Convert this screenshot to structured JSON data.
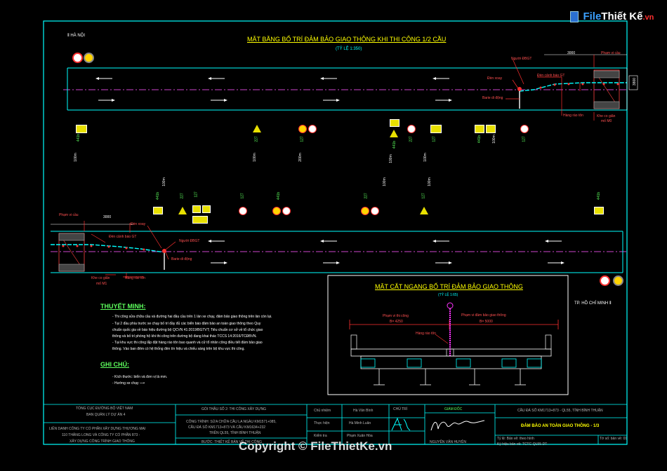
{
  "logo": {
    "brand_a": "File",
    "brand_b": "Thiết Kế",
    "brand_c": ".vn"
  },
  "plan": {
    "title": "MẶT BẰNG BỐ TRÍ ĐẢM BẢO GIAO THÔNG KHI THI CÔNG 1/2 CẦU",
    "scale": "(TỶ LỆ 1:350)",
    "dir_top": "HÀ NỘI",
    "dir_bottom": "TP. HỒ CHÍ MINH"
  },
  "labels_top": {
    "nguoi_dieu_tiet": "Người ĐBGT",
    "den_xoay": "Đèn xoay",
    "den_canh_bao": "Đèn cảnh báo GT",
    "barie": "Barie di động",
    "hang_rao": "Hàng rào tôn",
    "khe_co_gian": "Khe co giãn",
    "mo": "mố M0",
    "pham_vi_cau": "Phạm vi cầu",
    "dim_3000": "3000",
    "dim_3800": "3800"
  },
  "labels_bottom": {
    "pham_vi_cau": "Phạm vi cầu",
    "dim_3000": "3000",
    "den_xoay": "Đèn xoay",
    "den_canh_bao": "Đèn cảnh báo GT",
    "nguoi_dieu_tiet": "Người ĐBGT",
    "barie": "Barie di động",
    "khe_co_gian": "Khe co giãn",
    "mo": "mố M1",
    "hang_rao": "Hàng rào tôn"
  },
  "signs_top_codes": [
    "441b",
    "227",
    "127",
    "441b",
    "227",
    "127",
    "441b",
    "127"
  ],
  "signs_top_dists": [
    "100m",
    "100m",
    "200m",
    "100m",
    "100m",
    "100m",
    "100m",
    "100m"
  ],
  "signs_bot_codes": [
    "441b",
    "227",
    "127",
    "127",
    "441b",
    "227",
    "127",
    "441b"
  ],
  "signs_bot_dists": [
    "100m",
    "100m",
    "200m",
    "100m",
    "100m",
    "100m",
    "100m",
    "100m"
  ],
  "explanation": {
    "heading": "THUYẾT MINH:",
    "lines": [
      "- Thi công sửa chữa cầu và đường hai đầu cầu trên 1 làn xe chạy, đảm bảo giao thông trên làn còn lại.",
      "- Tại 2 đầu phía trước xe chạy bố trí đầy đủ các biển báo đảm bảo an toàn giao thông theo Quy",
      "chuẩn quốc gia về báo hiệu đường bộ QCVN 41:2019/BGTVT; Tiêu chuẩn cơ sở về tổ chức giao",
      "thông và bố trí phòng hộ khi thi công trên đường bộ đang khai thác TCCS 14:2016/TCĐBVN.",
      "- Tại khu vực thi công lắp đặt hàng rào tôn bao quanh và cử tổ nhân công điều tiết đảm bảo giao",
      "thông. Vào ban đêm có hệ thống đèn tín hiệu và chiếu sáng trên bộ khu vực thi công."
    ],
    "notes_heading": "GHI CHÚ:",
    "notes": [
      "- Kích thước: biển và đơn vị là mm.",
      "- Hướng xe chạy"
    ]
  },
  "section": {
    "title": "MẶT CẮT NGANG BỐ TRÍ ĐẢM BẢO GIAO THÔNG",
    "scale": "(TỶ LỆ 1:65)",
    "left_label": "Phạm vi thi công",
    "left_dim": "B= 4250",
    "right_label": "Phạm vi đảm bảo giao thông",
    "right_dim": "B= 5000",
    "fence": "Hàng rào tôn"
  },
  "titleblock": {
    "org1": "TỔNG CỤC ĐƯỜNG BỘ VIỆT NAM",
    "org2": "BAN QUẢN LÝ DỰ ÁN 4",
    "joint1": "LIÊN DANH CÔNG TY CỔ PHẦN XÂY DỰNG THƯƠNG MẠI",
    "joint2": "110 THĂNG LONG VÀ CÔNG TY CỔ PHẦN 873 -",
    "joint3": "XÂY DỰNG CÔNG TRÌNH GIAO THÔNG",
    "package": "GÓI THẦU SỐ 2: THI CÔNG XÂY DỰNG",
    "project1": "CÔNG TRÌNH: SỬA CHỮA CẦU LA NGÀU KM1571+085,",
    "project2": "CẦU ĐÁ SỐ KM1713+873 VÀ CẦU KM1634+232",
    "project3": "TRÊN QL55, TỈNH BÌNH THUẬN",
    "design_step": "BƯỚC: THIẾT KẾ BẢN VẼ THI CÔNG",
    "role1": "Chủ nhiệm",
    "role2": "Thực hiện",
    "role3": "Kiểm tra",
    "name1": "Hà Văn Bình",
    "name2": "Hà Minh Luân",
    "name3": "Phạm Xuân Hòa",
    "stamp": "CHỦ TRÌ",
    "director": "GIÁM ĐỐC",
    "director_name": "NGUYỄN VĂN HUYÊN",
    "bridge": "CẦU ĐÁ SỐ KM1713+873 - QL55, TỈNH BÌNH THUẬN",
    "drawing": "ĐẢM BẢO AN TOÀN GIAO THÔNG - 1/3",
    "scale_info": "Tỷ lệ: Bản vẽ: theo hình",
    "sheet_info": "Tờ số: bản vẽ: 01",
    "code_info": "Ký hiệu bản vẽ: TCTC-QL55-DT-"
  },
  "watermark": "Copyright © FileThietKe.vn",
  "colors": {
    "road": "#00ffff",
    "axis": "#cc44cc",
    "title": "#ffff00",
    "frame": "#00ffff"
  }
}
